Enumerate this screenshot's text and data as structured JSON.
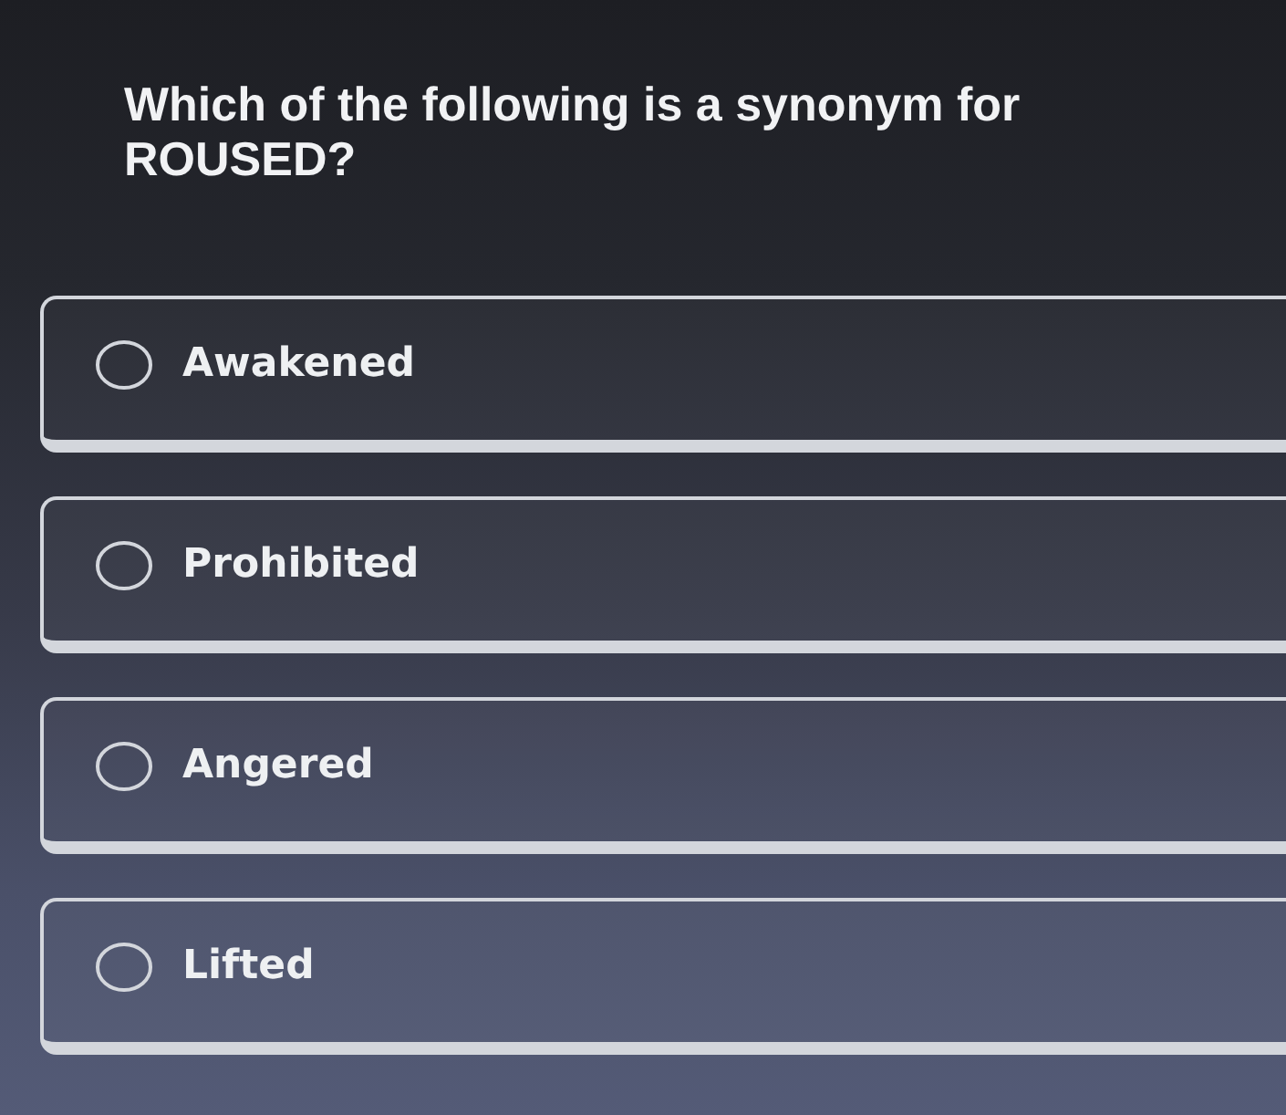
{
  "question": "Which of the following is a synonym for ROUSED?",
  "options": [
    {
      "label": "Awakened",
      "selected": false
    },
    {
      "label": "Prohibited",
      "selected": false
    },
    {
      "label": "Angered",
      "selected": false
    },
    {
      "label": "Lifted",
      "selected": false
    }
  ]
}
